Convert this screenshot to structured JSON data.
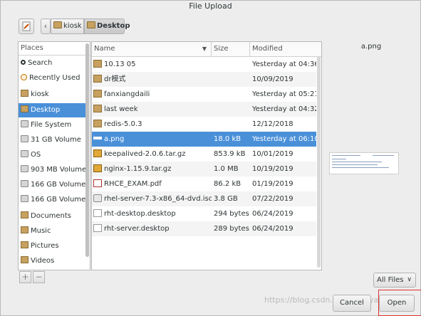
{
  "window": {
    "title": "File Upload"
  },
  "breadcrumb": {
    "items": [
      "kiosk",
      "Desktop"
    ]
  },
  "places": {
    "header": "Places",
    "items": [
      {
        "label": "Search",
        "icon": "search-icon"
      },
      {
        "label": "Recently Used",
        "icon": "clock-icon"
      },
      {
        "label": "kiosk",
        "icon": "folder-icon"
      },
      {
        "label": "Desktop",
        "icon": "folder-icon"
      },
      {
        "label": "File System",
        "icon": "drive-icon"
      },
      {
        "label": "31 GB Volume",
        "icon": "drive-icon"
      },
      {
        "label": "OS",
        "icon": "drive-icon"
      },
      {
        "label": "903 MB Volume",
        "icon": "drive-icon"
      },
      {
        "label": "166 GB Volume",
        "icon": "drive-icon"
      },
      {
        "label": "166 GB Volume",
        "icon": "drive-icon"
      },
      {
        "label": "Documents",
        "icon": "folder-icon"
      },
      {
        "label": "Music",
        "icon": "folder-icon"
      },
      {
        "label": "Pictures",
        "icon": "folder-icon"
      },
      {
        "label": "Videos",
        "icon": "folder-icon"
      }
    ],
    "selected": "Desktop",
    "add_label": "+",
    "remove_label": "−"
  },
  "files": {
    "columns": {
      "name": "Name",
      "size": "Size",
      "modified": "Modified"
    },
    "rows": [
      {
        "name": "10.13 05",
        "size": "",
        "modified": "Yesterday at 04:36",
        "icon": "folder-icon"
      },
      {
        "name": "dr模式",
        "size": "",
        "modified": "10/09/2019",
        "icon": "folder-icon"
      },
      {
        "name": "fanxiangdaili",
        "size": "",
        "modified": "Yesterday at 05:21",
        "icon": "folder-icon"
      },
      {
        "name": "last week",
        "size": "",
        "modified": "Yesterday at 04:32",
        "icon": "folder-icon"
      },
      {
        "name": "redis-5.0.3",
        "size": "",
        "modified": "12/12/2018",
        "icon": "folder-icon"
      },
      {
        "name": "a.png",
        "size": "18.0 kB",
        "modified": "Yesterday at 06:10",
        "icon": "image-icon"
      },
      {
        "name": "keepalived-2.0.6.tar.gz",
        "size": "853.9 kB",
        "modified": "10/01/2019",
        "icon": "archive-icon"
      },
      {
        "name": "nginx-1.15.9.tar.gz",
        "size": "1.0 MB",
        "modified": "10/19/2019",
        "icon": "archive-icon"
      },
      {
        "name": "RHCE_EXAM.pdf",
        "size": "86.2 kB",
        "modified": "01/19/2019",
        "icon": "pdf-icon"
      },
      {
        "name": "rhel-server-7.3-x86_64-dvd.iso",
        "size": "3.8 GB",
        "modified": "07/22/2019",
        "icon": "disc-icon"
      },
      {
        "name": "rht-desktop.desktop",
        "size": "294 bytes",
        "modified": "06/24/2019",
        "icon": "document-icon"
      },
      {
        "name": "rht-server.desktop",
        "size": "289 bytes",
        "modified": "06/24/2019",
        "icon": "document-icon"
      }
    ],
    "selected": "a.png"
  },
  "preview": {
    "filename": "a.png"
  },
  "filter": {
    "value": "All Files"
  },
  "buttons": {
    "cancel": "Cancel",
    "open": "Open"
  },
  "watermark": "https://blog.csdn.net/asdqiya",
  "colors": {
    "selection": "#4a90d9",
    "highlight_box": "#e03030"
  }
}
